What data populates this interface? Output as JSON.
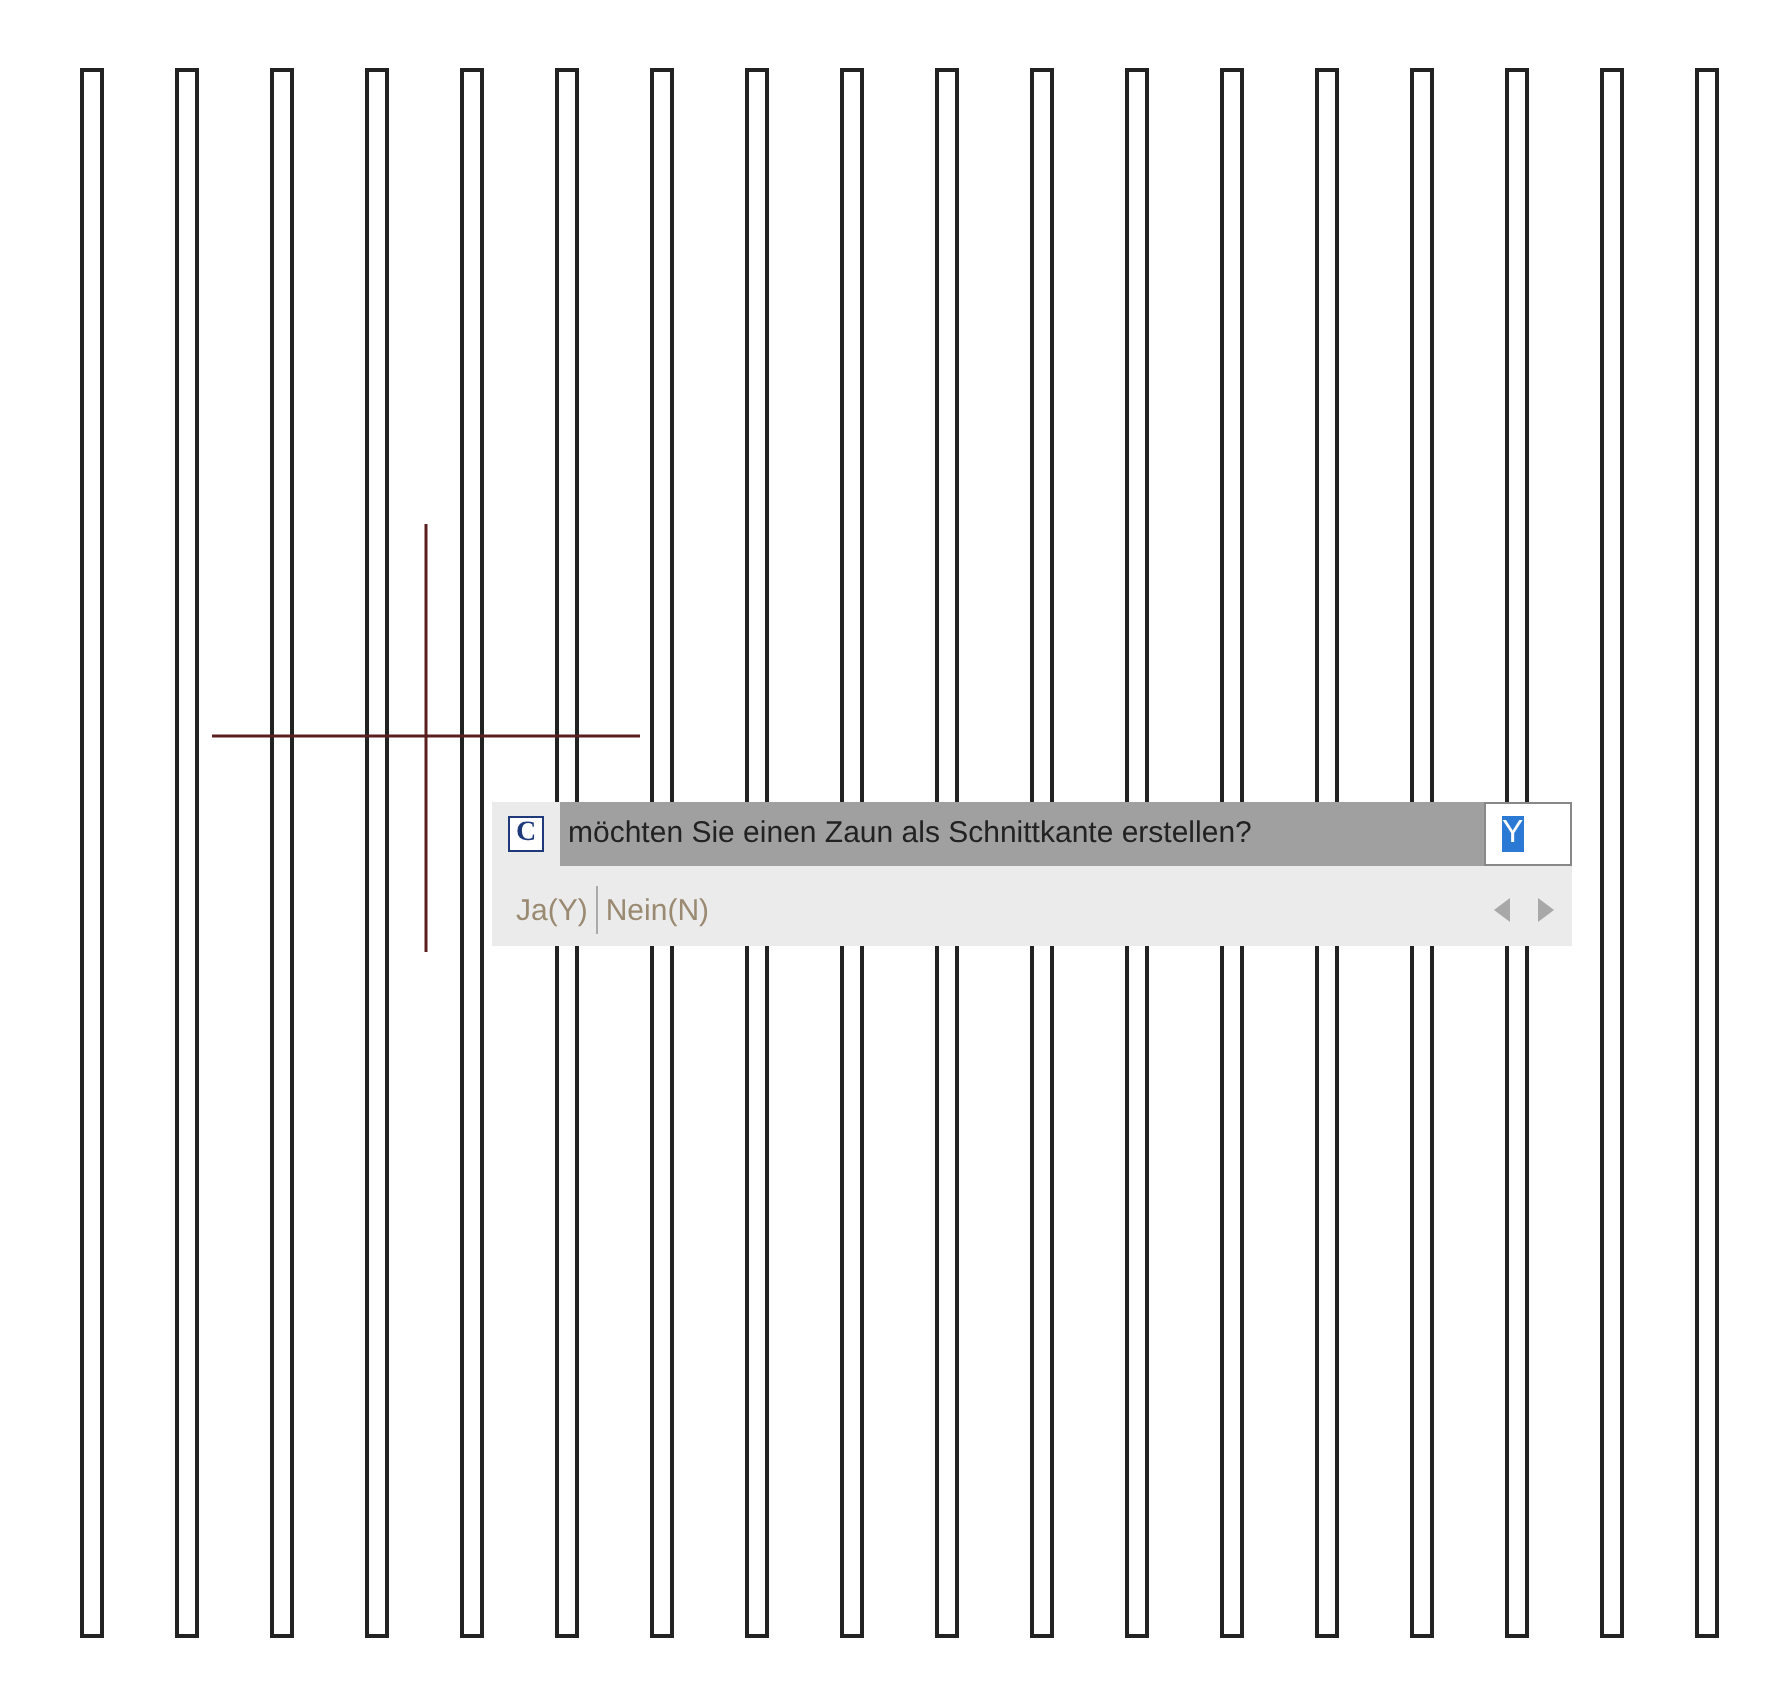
{
  "command_prompt": {
    "icon_letter": "C",
    "text": "möchten Sie einen Zaun als Schnittkante erstellen?",
    "input": {
      "value": "Y",
      "selected": true
    },
    "options": [
      {
        "label": "Ja(Y)"
      },
      {
        "label": "Nein(N)"
      }
    ]
  }
}
